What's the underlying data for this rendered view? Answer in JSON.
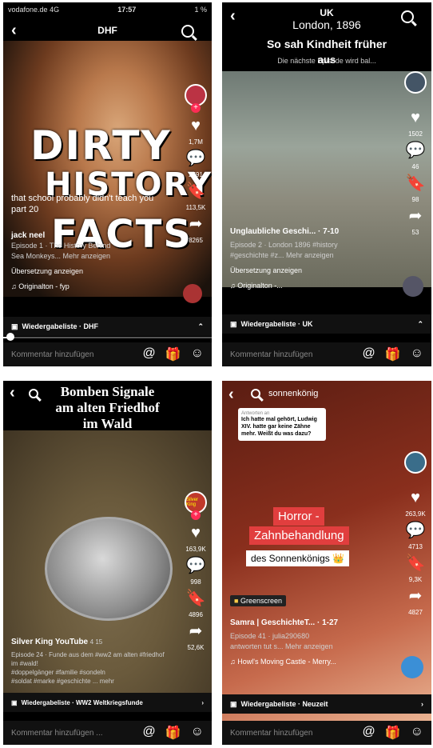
{
  "panel1": {
    "status": {
      "carrier": "vodafone.de",
      "network": "4G",
      "time": "17:57",
      "battery": "1 %"
    },
    "title": "DHF",
    "overlay_line1": "DIRTY",
    "overlay_line2": "HISTORY",
    "overlay_line3": "FACTS",
    "subtitle": "that school probably didn't teach you part 20",
    "author": "jack neel",
    "episode": "Episode 1 · The History Behind",
    "desc": "Sea Monkeys... Mehr anzeigen",
    "translate": "Übersetzung anzeigen",
    "sound": "Originalton - fyp",
    "playlist": "Wiedergabeliste · DHF",
    "comment_placeholder": "Kommentar hinzufügen",
    "counts": {
      "likes": "1,7M",
      "comments": "2791",
      "saves": "113,5K",
      "shares": "8265"
    },
    "progress": 0.03
  },
  "panel2": {
    "header_top": "UK",
    "header_city": "London, 1896",
    "header_title": "So sah Kindheit früher",
    "header_title2": "aus",
    "next_episode": "Die nächste Episode wird bal...",
    "caption_title": "Unglaubliche Geschi... · 7-10",
    "episode": "Episode 2 · London 1896 #history",
    "tags": "#geschichte #z... Mehr anzeigen",
    "translate": "Übersetzung anzeigen",
    "sound": "Originalton -...",
    "playlist": "Wiedergabeliste · UK",
    "comment_placeholder": "Kommentar hinzufügen",
    "counts": {
      "likes": "1502",
      "comments": "46",
      "saves": "98",
      "shares": "53"
    }
  },
  "panel3": {
    "overlay_line1": "Bomben Signale",
    "overlay_line2": "am alten Friedhof",
    "overlay_line3": "im Wald",
    "author": "Silver King YouTube",
    "age": "4 15",
    "episode": "Episode 24 · Funde aus dem #ww2 am alten #friedhof im #wald!",
    "tags": "#doppelgänger #familie #sondeln",
    "tags2": "#soldat #marke #geschichte ... mehr",
    "playlist": "Wiedergabeliste · WW2 Weltkriegsfunde",
    "comment_placeholder": "Kommentar hinzufügen ...",
    "counts": {
      "likes": "163,9K",
      "comments": "998",
      "saves": "4896",
      "shares": "52,6K"
    },
    "badge": "Silver King"
  },
  "panel4": {
    "search_text": "sonnenkönig",
    "reply_user": "Antworten an",
    "reply_text": "Ich hatte mal gehört, Ludwig XIV. hatte gar keine Zähne mehr. Weißt du was dazu?",
    "label1": "Horror -",
    "label2": "Zahnbehandlung",
    "label3": "des Sonnenkönigs 👑",
    "greenscreen": "Greenscreen",
    "caption_title": "Samra | GeschichteT... · 1-27",
    "episode": "Episode 41 · julia290680",
    "desc": "antworten tut s... Mehr anzeigen",
    "sound": "Howl's Moving Castle - Merry...",
    "playlist": "Wiedergabeliste · Neuzeit",
    "comment_placeholder": "Kommentar hinzufügen",
    "counts": {
      "likes": "263,9K",
      "comments": "4713",
      "saves": "9,3K",
      "shares": "4827"
    }
  }
}
